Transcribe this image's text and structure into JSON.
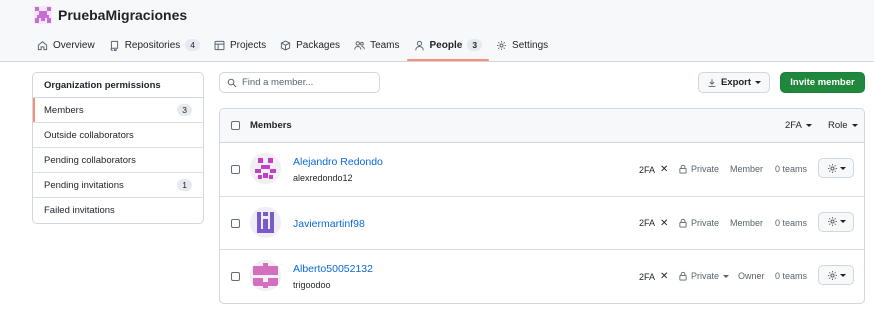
{
  "org": {
    "name": "PruebaMigraciones",
    "avatar_color": "#c86dd7"
  },
  "nav": [
    {
      "label": "Overview",
      "icon": "home-icon"
    },
    {
      "label": "Repositories",
      "icon": "repo-icon",
      "count": "4"
    },
    {
      "label": "Projects",
      "icon": "table-icon"
    },
    {
      "label": "Packages",
      "icon": "package-icon"
    },
    {
      "label": "Teams",
      "icon": "people-icon"
    },
    {
      "label": "People",
      "icon": "person-icon",
      "count": "3",
      "selected": true
    },
    {
      "label": "Settings",
      "icon": "gear-icon"
    }
  ],
  "sidebar": {
    "title": "Organization permissions",
    "items": [
      {
        "label": "Members",
        "count": "3",
        "selected": true
      },
      {
        "label": "Outside collaborators"
      },
      {
        "label": "Pending collaborators"
      },
      {
        "label": "Pending invitations",
        "count": "1"
      },
      {
        "label": "Failed invitations"
      }
    ]
  },
  "search": {
    "placeholder": "Find a member..."
  },
  "buttons": {
    "export": "Export",
    "invite": "Invite member"
  },
  "table": {
    "title": "Members",
    "filters": {
      "twofa": "2FA",
      "role": "Role"
    },
    "members": [
      {
        "name": "Alejandro Redondo",
        "login": "alexredondo12",
        "twofa": "2FA",
        "visibility": "Private",
        "role": "Member",
        "teams": "0 teams",
        "avatar_color": "#c23fc9"
      },
      {
        "name": "Javiermartinf98",
        "login": "",
        "twofa": "2FA",
        "visibility": "Private",
        "role": "Member",
        "teams": "0 teams",
        "avatar_color": "#7a5ac8"
      },
      {
        "name": "Alberto50052132",
        "login": "trigoodoo",
        "twofa": "2FA",
        "visibility": "Private",
        "role": "Owner",
        "teams": "0 teams",
        "avatar_color": "#d46fbf"
      }
    ]
  },
  "colors": {
    "accent_underline": "#fd8c73",
    "primary_button": "#1f883d",
    "link": "#0969da"
  }
}
